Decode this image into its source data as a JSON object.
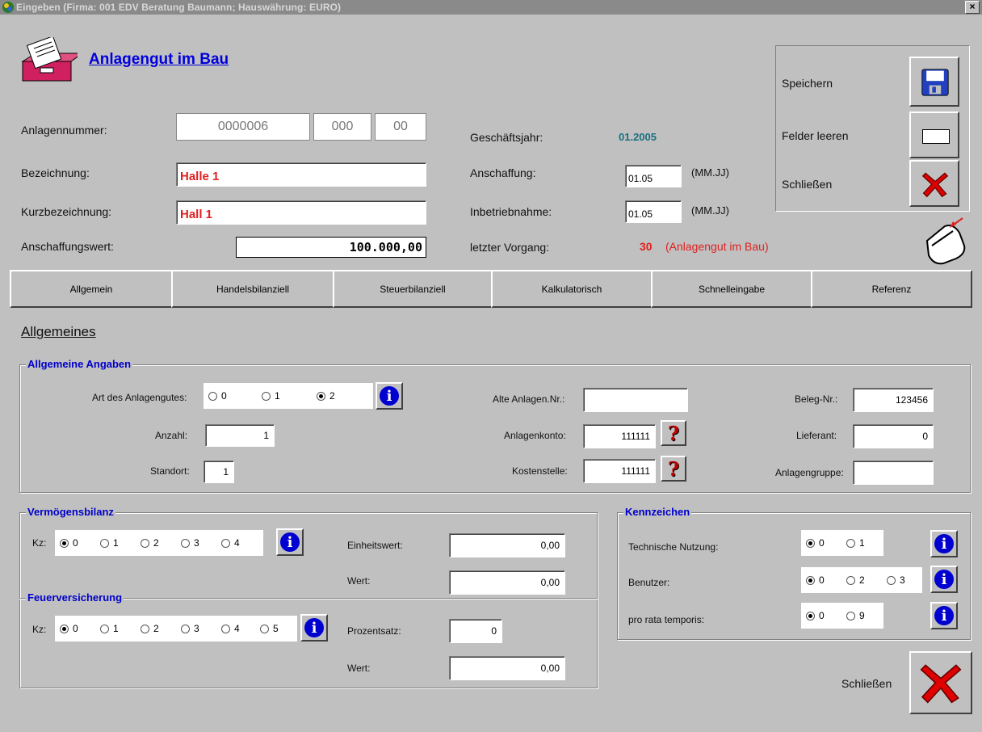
{
  "window": {
    "title": "Eingeben  (Firma: 001 EDV Beratung Baumann;   Hauswährung: EURO)",
    "close": "×"
  },
  "header": {
    "title": "Anlagengut im Bau"
  },
  "top": {
    "anlagennummer_label": "Anlagennummer:",
    "anlagennummer": [
      "0000006",
      "000",
      "00"
    ],
    "bezeichnung_label": "Bezeichnung:",
    "bezeichnung": "Halle 1",
    "kurz_label": "Kurzbezeichnung:",
    "kurz": "Hall 1",
    "wert_label": "Anschaffungswert:",
    "wert": "100.000,00",
    "gj_label": "Geschäftsjahr:",
    "gj": "01.2005",
    "anschaffung_label": "Anschaffung:",
    "anschaffung": "01.05",
    "inbetrieb_label": "Inbetriebnahme:",
    "inbetrieb": "01.05",
    "mmjj": "(MM.JJ)",
    "vorgang_label": "letzter Vorgang:",
    "vorgang_nr": "30",
    "vorgang_text": "(Anlagengut im Bau)"
  },
  "actions": {
    "speichern": "Speichern",
    "leeren": "Felder leeren",
    "schliessen": "Schließen"
  },
  "tabs": [
    "Allgemein",
    "Handelsbilanziell",
    "Steuerbilanziell",
    "Kalkulatorisch",
    "Schnelleingabe",
    "Referenz"
  ],
  "section_title": "Allgemeines",
  "allgemein": {
    "legend": "Allgemeine Angaben",
    "art_label": "Art des Anlagengutes:",
    "art_options": [
      "0",
      "1",
      "2"
    ],
    "anzahl_label": "Anzahl:",
    "anzahl": "1",
    "standort_label": "Standort:",
    "standort": "1",
    "alte_label": "Alte Anlagen.Nr.:",
    "alte": "",
    "konto_label": "Anlagenkonto:",
    "konto": "111111",
    "kst_label": "Kostenstelle:",
    "kst": "111111",
    "beleg_label": "Beleg-Nr.:",
    "beleg": "123456",
    "lieferant_label": "Lieferant:",
    "lieferant": "0",
    "gruppe_label": "Anlagengruppe:",
    "gruppe": ""
  },
  "vermoegen": {
    "legend": "Vermögensbilanz",
    "kz_label": "Kz:",
    "kz_options": [
      "0",
      "1",
      "2",
      "3",
      "4"
    ],
    "einheit_label": "Einheitswert:",
    "einheit": "0,00",
    "wert_label": "Wert:",
    "wert": "0,00"
  },
  "feuer": {
    "legend": "Feuerversicherung",
    "kz_label": "Kz:",
    "kz_options": [
      "0",
      "1",
      "2",
      "3",
      "4",
      "5"
    ],
    "prozent_label": "Prozentsatz:",
    "prozent": "0",
    "wert_label": "Wert:",
    "wert": "0,00"
  },
  "kennzeichen": {
    "legend": "Kennzeichen",
    "tech_label": "Technische Nutzung:",
    "tech_options": [
      "0",
      "1"
    ],
    "benutzer_label": "Benutzer:",
    "benutzer_options": [
      "0",
      "2",
      "3"
    ],
    "prt_label": "pro rata temporis:",
    "prt_options": [
      "0",
      "9"
    ]
  },
  "footer": {
    "schliessen": "Schließen"
  },
  "icons": {
    "info": "i",
    "question": "?"
  }
}
